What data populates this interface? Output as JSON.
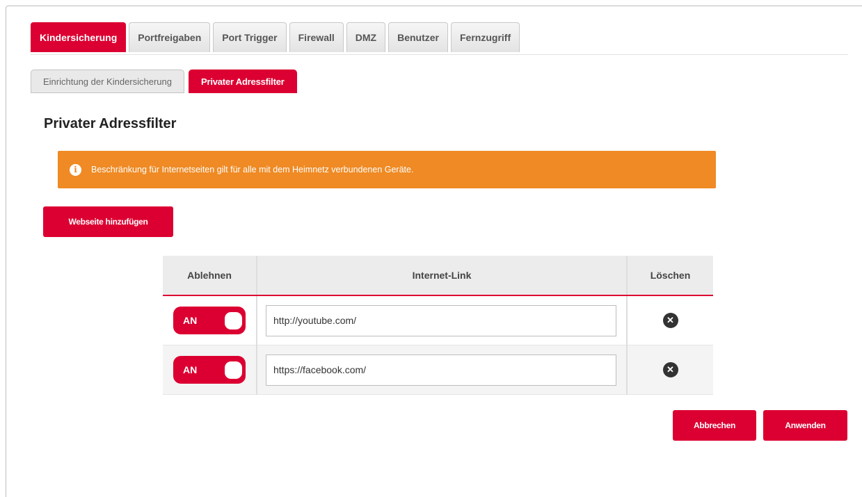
{
  "tabs": [
    {
      "label": "Kindersicherung",
      "active": true
    },
    {
      "label": "Portfreigaben",
      "active": false
    },
    {
      "label": "Port Trigger",
      "active": false
    },
    {
      "label": "Firewall",
      "active": false
    },
    {
      "label": "DMZ",
      "active": false
    },
    {
      "label": "Benutzer",
      "active": false
    },
    {
      "label": "Fernzugriff",
      "active": false
    }
  ],
  "subtabs": [
    {
      "label": "Einrichtung der Kindersicherung",
      "active": false
    },
    {
      "label": "Privater Adressfilter",
      "active": true
    }
  ],
  "page_title": "Privater Adressfilter",
  "alert": {
    "icon": "info-icon",
    "icon_glyph": "i",
    "text": "Beschränkung für Internetseiten gilt für alle mit dem Heimnetz verbundenen Geräte."
  },
  "add_button_label": "Webseite hinzufügen",
  "table": {
    "headers": {
      "deny": "Ablehnen",
      "link": "Internet-Link",
      "delete": "Löschen"
    },
    "rows": [
      {
        "toggle_label": "AN",
        "url": "http://youtube.com/"
      },
      {
        "toggle_label": "AN",
        "url": "https://facebook.com/"
      }
    ],
    "delete_glyph": "✕"
  },
  "actions": {
    "cancel": "Abbrechen",
    "apply": "Anwenden"
  },
  "colors": {
    "accent": "#dc0032",
    "alert": "#ef8a24"
  }
}
